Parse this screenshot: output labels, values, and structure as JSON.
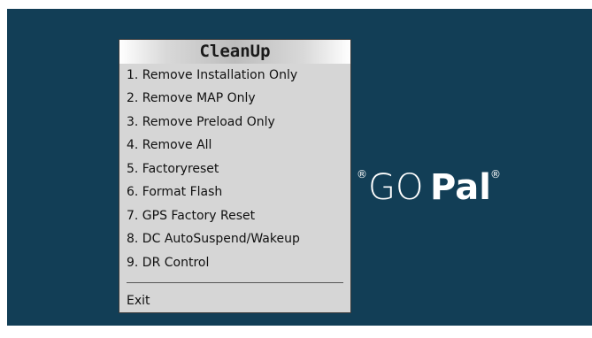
{
  "menu": {
    "title": "CleanUp",
    "items": [
      {
        "label": "1. Remove Installation Only"
      },
      {
        "label": "2. Remove MAP Only"
      },
      {
        "label": "3. Remove Preload Only"
      },
      {
        "label": "4. Remove All"
      },
      {
        "label": "5. Factoryreset"
      },
      {
        "label": "6. Format Flash"
      },
      {
        "label": "7. GPS Factory Reset"
      },
      {
        "label": "8. DC AutoSuspend/Wakeup"
      },
      {
        "label": "9. DR Control"
      }
    ],
    "exit_label": "Exit"
  },
  "logo": {
    "reg_mark": "®",
    "go_text": "GO",
    "pal_text": "Pal"
  },
  "colors": {
    "background": "#123e56",
    "menu_background": "#d6d6d6",
    "menu_text": "#111111"
  }
}
